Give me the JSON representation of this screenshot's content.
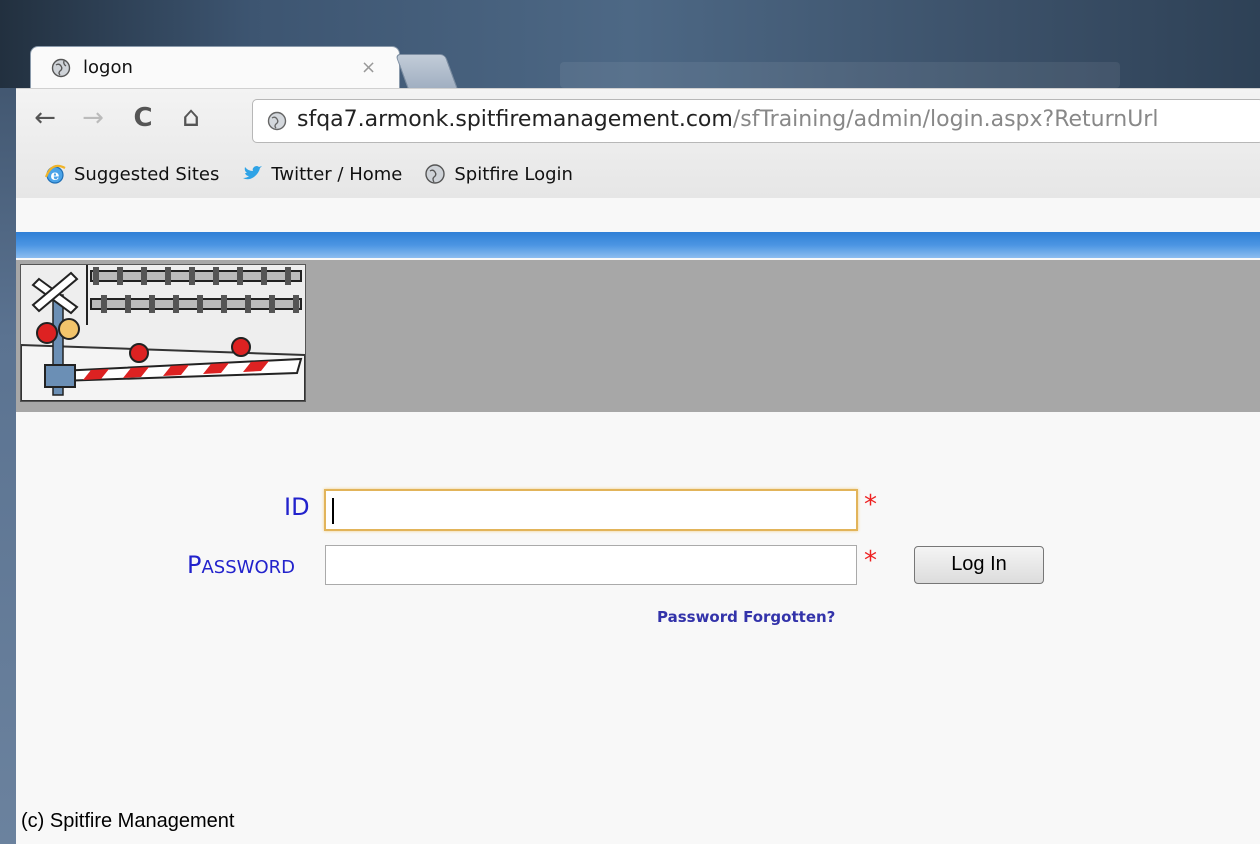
{
  "browser": {
    "tab_title": "logon",
    "tab_close": "×",
    "url_domain": "sfqa7.armonk.spitfiremanagement.com",
    "url_path": "/sfTraining/admin/login.aspx?ReturnUrl",
    "nav": {
      "back": "←",
      "forward": "→",
      "reload": "C",
      "home": "⌂"
    }
  },
  "bookmarks": [
    {
      "label": "Suggested Sites",
      "icon": "ie-icon"
    },
    {
      "label": "Twitter / Home",
      "icon": "twitter-bird-icon"
    },
    {
      "label": "Spitfire Login",
      "icon": "globe-icon"
    }
  ],
  "form": {
    "id_label": "ID",
    "password_label_first": "P",
    "password_label_rest": "ASSWORD",
    "id_value": "",
    "password_value": "",
    "required_mark": "*",
    "login_button": "Log In",
    "forgot_link": "Password Forgotten?"
  },
  "footer": {
    "copyright": "(c) Spitfire Management"
  },
  "colors": {
    "label_blue": "#2222cc",
    "required_red": "#e22222",
    "header_blue": "#2f7fd6",
    "header_gray": "#a7a7a7"
  }
}
